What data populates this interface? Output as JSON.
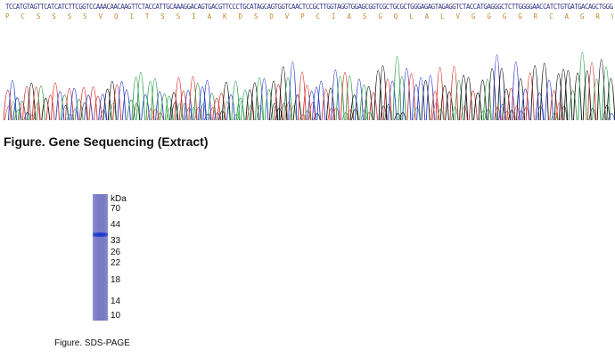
{
  "gene_sequencing": {
    "dna_sequence": "TCCATGTAGTTCATCATCTTCGGTCCAAACAACAAGTTCTACCATTGCAAAGGACAGTGACGTTCCCTGCATAGCAGTGGTCAACTCCGCTTGGTAGGTGGAGCGGTCGCTGCGCTGGGAGAGTAGAGGTCTACCATGAGGGCTCTTGGGGAACCATCTGTGATGACAGCTGGGATCTGACGGA",
    "amino_acid_sequence": "P C S S S S V Q I T S S I A K D S D V P C I A S G Q L A L V G G G G R C A G R V E Y H E G S W G T I C D D S W D L T D",
    "caption": "Figure. Gene Sequencing (Extract)",
    "trace_colors": {
      "A": "#2e9e4c",
      "C": "#2a3cc8",
      "G": "#111111",
      "T": "#d2322d"
    }
  },
  "sds_page": {
    "unit_label": "kDa",
    "markers": [
      "70",
      "44",
      "33",
      "26",
      "22",
      "18",
      "14",
      "10"
    ],
    "caption": "Figure. SDS-PAGE",
    "gel_color": "#7a7cc6",
    "band_color": "#1433c8"
  }
}
